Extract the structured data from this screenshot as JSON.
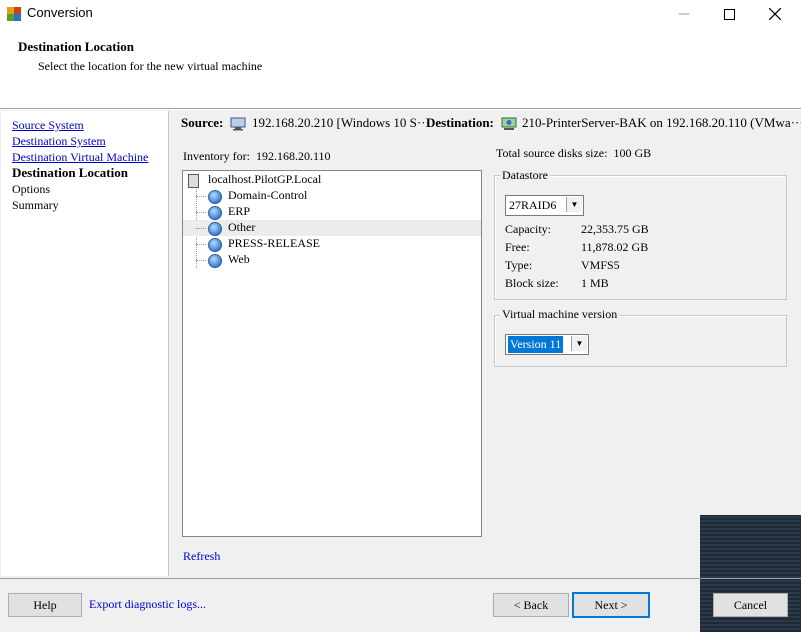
{
  "window": {
    "title": "Conversion",
    "min_icon": "minimize-icon",
    "max_icon": "maximize-icon",
    "close_icon": "close-icon"
  },
  "header": {
    "title": "Destination Location",
    "subtitle": "Select the location for the new virtual machine"
  },
  "nav": {
    "items": [
      {
        "label": "Source System",
        "state": "link"
      },
      {
        "label": "Destination System",
        "state": "link"
      },
      {
        "label": "Destination Virtual Machine",
        "state": "link"
      },
      {
        "label": "Destination Location",
        "state": "current"
      },
      {
        "label": "Options",
        "state": "plain"
      },
      {
        "label": "Summary",
        "state": "plain"
      }
    ]
  },
  "summary_line": {
    "source_label": "Source:",
    "source_value": "192.168.20.210 [Windows 10 S···",
    "destination_label": "Destination:",
    "destination_value": "210-PrinterServer-BAK on 192.168.20.110 (VMwa···"
  },
  "inventory": {
    "label": "Inventory for:",
    "host": "192.168.20.110",
    "root": "localhost.PilotGP.Local",
    "pools": [
      "Domain-Control",
      "ERP",
      "Other",
      "PRESS-RELEASE",
      "Web"
    ],
    "selected": "Other",
    "refresh_label": "Refresh"
  },
  "disks": {
    "label": "Total source disks size:",
    "value": "100 GB"
  },
  "datastore": {
    "group_label": "Datastore",
    "selected": "27RAID6",
    "capacity_label": "Capacity:",
    "capacity": "22,353.75 GB",
    "free_label": "Free:",
    "free": "11,878.02 GB",
    "type_label": "Type:",
    "type": "VMFS5",
    "block_label": "Block size:",
    "block": "1 MB"
  },
  "vm_version": {
    "group_label": "Virtual machine version",
    "selected": "Version 11"
  },
  "buttons": {
    "help": "Help",
    "export": "Export diagnostic logs...",
    "back": "< Back",
    "next": "Next >",
    "cancel": "Cancel"
  },
  "colors": {
    "link": "#0000cc",
    "selection": "#0078d7",
    "background": "#f0f0f0"
  }
}
